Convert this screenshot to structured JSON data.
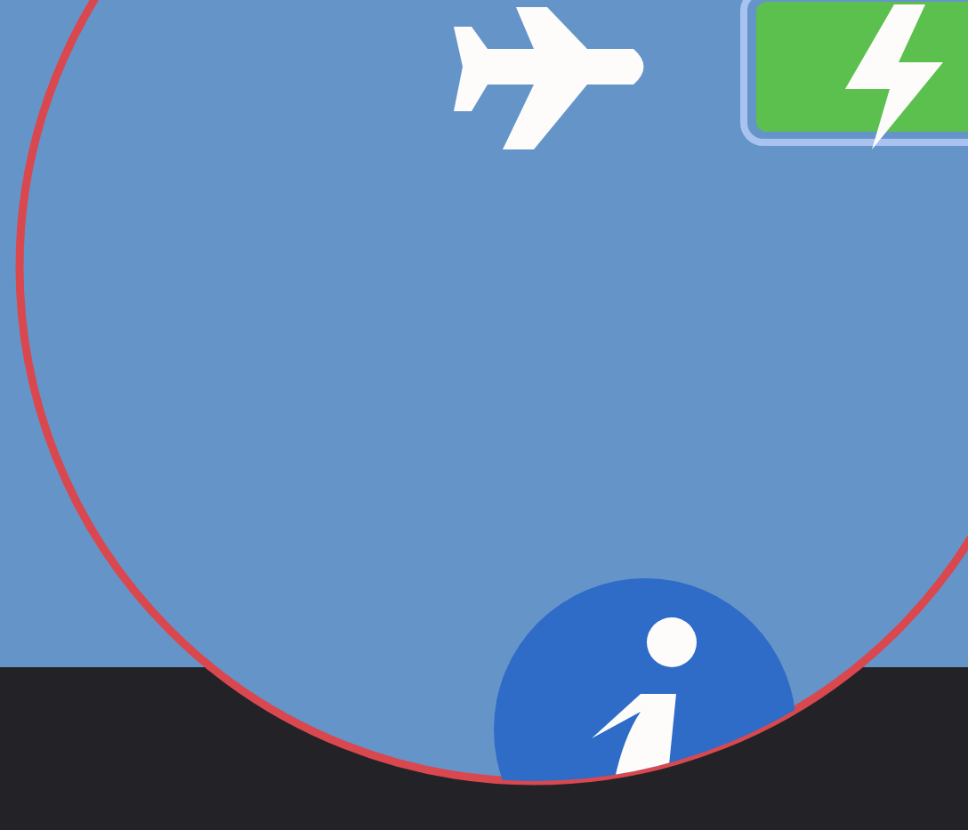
{
  "status_bar": {
    "airplane_mode": true,
    "charging": true
  }
}
